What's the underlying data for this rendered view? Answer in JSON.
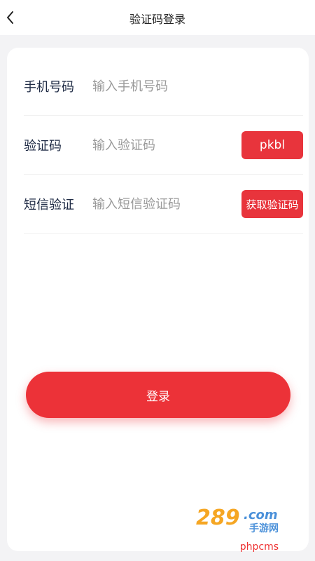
{
  "nav": {
    "title": "验证码登录",
    "back_icon": "chevron-left-icon"
  },
  "form": {
    "phone": {
      "label": "手机号码",
      "placeholder": "输入手机号码"
    },
    "captcha": {
      "label": "验证码",
      "placeholder": "输入验证码",
      "code": "pkbl"
    },
    "sms": {
      "label": "短信验证",
      "placeholder": "输入短信验证码",
      "button": "获取验证码"
    }
  },
  "login": {
    "label": "登录"
  },
  "watermark": {
    "logo_text": "289.com 手游网",
    "footer": "phpcms"
  },
  "colors": {
    "accent": "#e8343c",
    "label": "#1e2a44",
    "placeholder": "#9a9a9a"
  }
}
